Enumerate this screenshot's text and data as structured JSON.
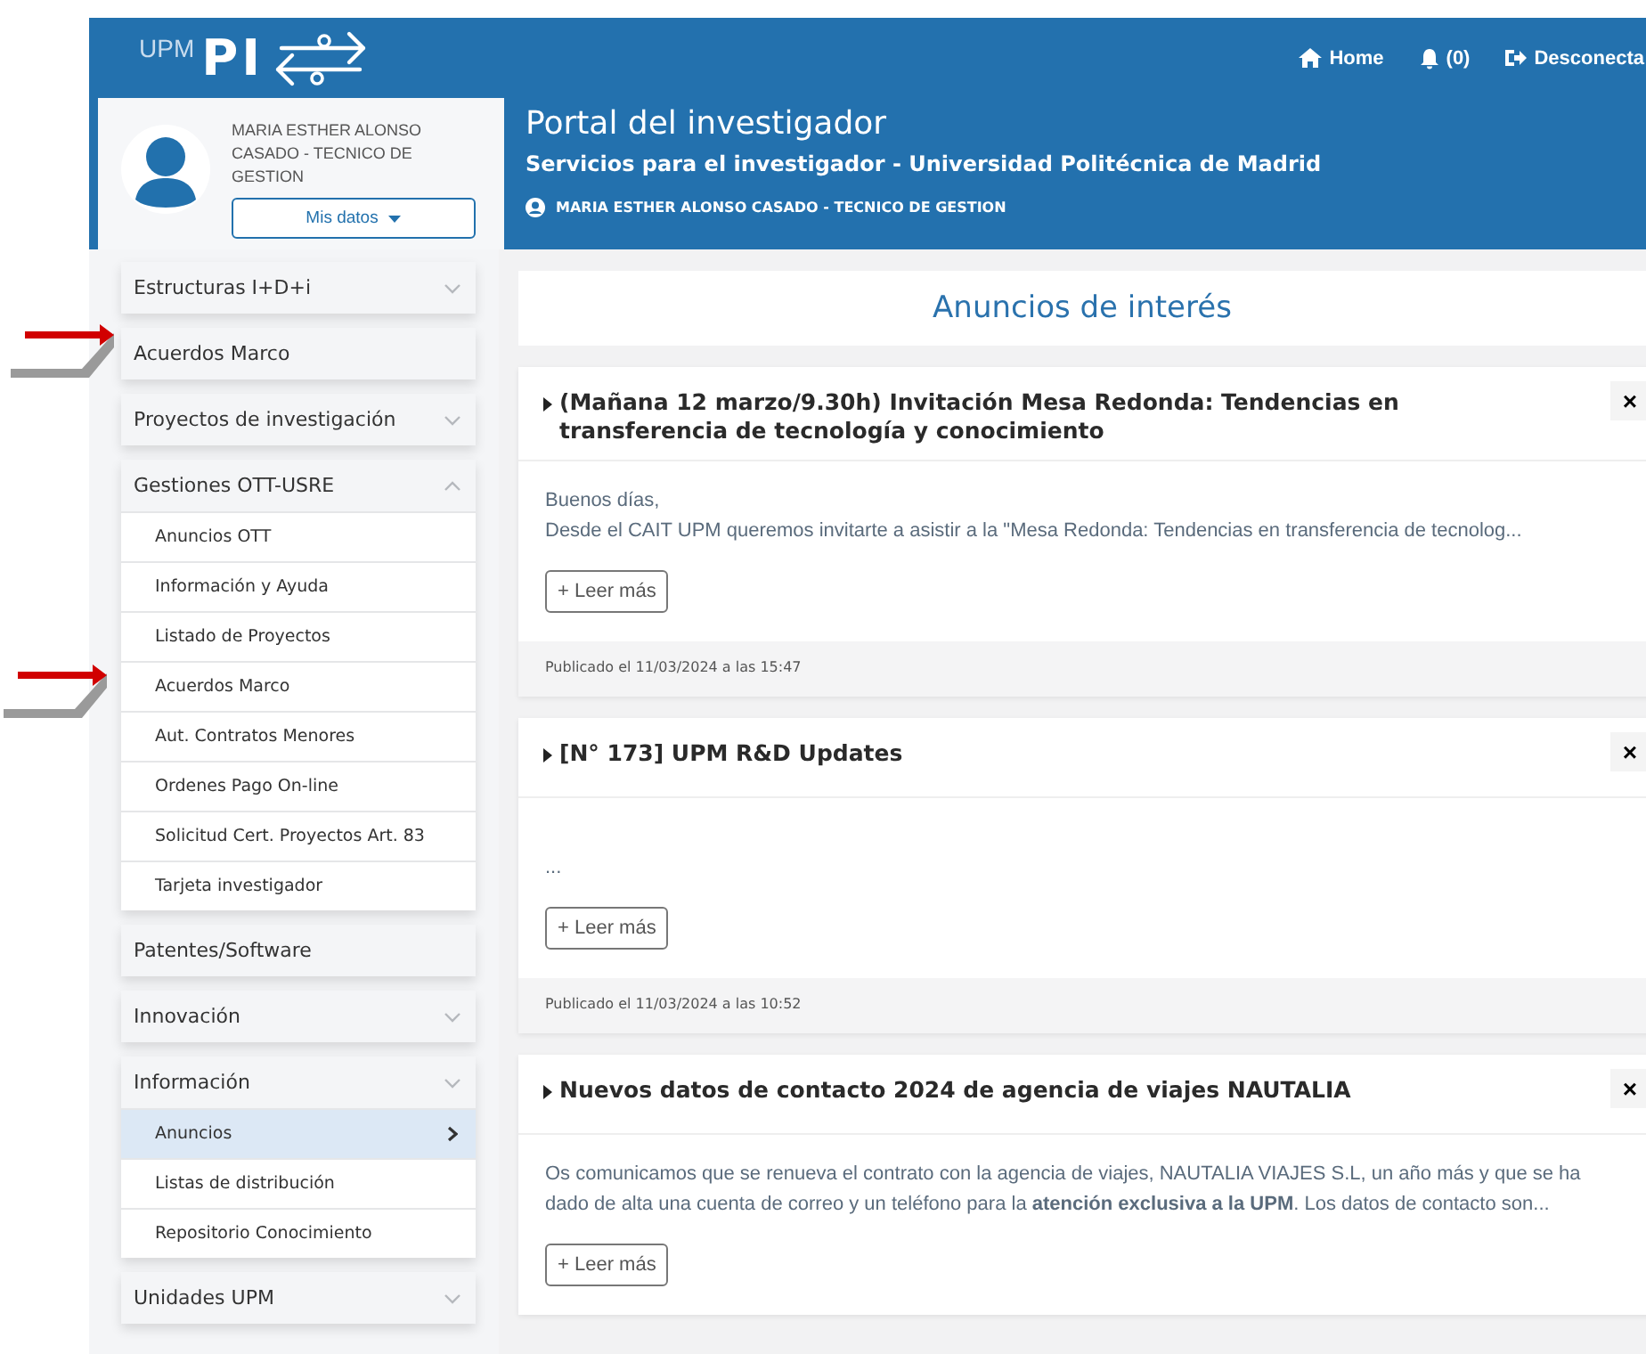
{
  "header": {
    "logo_small": "UPM",
    "logo_big": "PI",
    "nav": [
      {
        "kind": "home",
        "label": "Home"
      },
      {
        "kind": "bell",
        "label": "(0)"
      },
      {
        "kind": "logout",
        "label": "Desconecta"
      }
    ]
  },
  "profile": {
    "name": "MARIA ESTHER ALONSO CASADO - TECNICO DE GESTION",
    "button": "Mis datos"
  },
  "portal": {
    "title": "Portal del investigador",
    "subtitle": "Servicios para el investigador - Universidad Politécnica de Madrid",
    "user": "MARIA ESTHER ALONSO CASADO - TECNICO DE GESTION"
  },
  "sidebar": {
    "sections": [
      {
        "label": "Estructuras I+D+i",
        "expanded": false
      },
      {
        "label": "Acuerdos Marco",
        "marked": true
      },
      {
        "label": "Proyectos de investigación",
        "expanded": false
      },
      {
        "label": "Gestiones OTT-USRE",
        "expanded": true,
        "children": [
          {
            "label": "Anuncios OTT",
            "selected": false
          },
          {
            "label": "Información y Ayuda",
            "selected": false
          },
          {
            "label": "Listado de Proyectos",
            "selected": false
          },
          {
            "label": "Acuerdos Marco",
            "selected": false,
            "marked": true
          },
          {
            "label": "Aut. Contratos Menores",
            "selected": false
          },
          {
            "label": "Ordenes Pago On-line",
            "selected": false
          },
          {
            "label": "Solicitud Cert. Proyectos Art. 83",
            "selected": false
          },
          {
            "label": "Tarjeta investigador",
            "selected": false
          }
        ]
      },
      {
        "label": "Patentes/Software"
      },
      {
        "label": "Innovación",
        "expanded": false
      },
      {
        "label": "Información",
        "expanded": false,
        "children": [
          {
            "label": "Anuncios",
            "selected": true
          },
          {
            "label": "Listas de distribución",
            "selected": false
          },
          {
            "label": "Repositorio Conocimiento",
            "selected": false
          }
        ]
      },
      {
        "label": "Unidades UPM",
        "expanded": false
      }
    ]
  },
  "announcements": {
    "heading": "Anuncios de interés",
    "posts": [
      {
        "title": "(Mañana 12 marzo/9.30h) Invitación Mesa Redonda: Tendencias en transferencia de tecnología y conocimiento",
        "close": "×",
        "body": [
          "Buenos días,",
          "Desde el CAIT UPM queremos invitarte a asistir a la \"Mesa Redonda: Tendencias en transferencia de tecnolog..."
        ],
        "button": "+ Leer más",
        "date": "Publicado el 11/03/2024 a las 15:47"
      },
      {
        "title": "[N° 173] UPM R&D Updates",
        "close": "×",
        "body": [
          "..."
        ],
        "button": "+ Leer más",
        "date": "Publicado el 11/03/2024 a las 10:52"
      },
      {
        "title": "Nuevos datos de contacto 2024 de agencia de viajes NAUTALIA",
        "close": "×",
        "body": [
          "Os comunicamos que se renueva el contrato con la agencia de viajes, NAUTALIA VIAJES S.L, un año más y que se ha",
          "dado de alta una cuenta de correo y un teléfono para la **atención exclusiva a la UPM**. Los datos de contacto son..."
        ],
        "button": "+ Leer más"
      }
    ]
  }
}
